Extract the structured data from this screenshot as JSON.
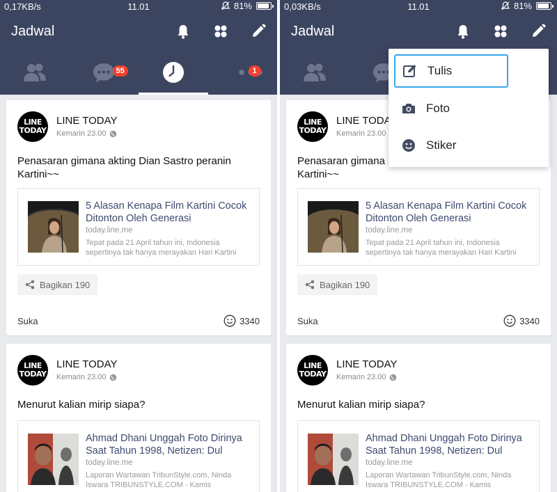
{
  "status_left": {
    "speed": "0,17KB/s",
    "time": "11.01",
    "battery": "81%",
    "battery_level": 0.81
  },
  "status_right": {
    "speed": "0,03KB/s",
    "time": "11.01",
    "battery": "81%",
    "battery_level": 0.81
  },
  "appbar": {
    "title": "Jadwal",
    "icons": [
      "bell-icon",
      "apps-grid-icon",
      "pencil-icon"
    ]
  },
  "tabs": [
    {
      "icon": "friends-icon",
      "badge": ""
    },
    {
      "icon": "chat-icon",
      "badge": "55"
    },
    {
      "icon": "timeline-clock-icon",
      "badge": "",
      "active": true
    },
    {
      "icon": "more-icon",
      "badge": "1"
    }
  ],
  "posts": [
    {
      "author": "LINE TODAY",
      "avatar_text": "LINE TODAY",
      "time": "Kemarin 23.00",
      "text": "Penasaran gimana akting Dian Sastro peranin Kartini~~",
      "link": {
        "title": "5 Alasan Kenapa Film Kartini Cocok Ditonton Oleh Generasi",
        "domain": "today.line.me",
        "description": "Tepat pada 21 April tahun ini, Indonesia sepertinya tak hanya merayakan Hari Kartini"
      },
      "share_label": "Bagikan 190",
      "like_label": "Suka",
      "reaction_count": "3340"
    },
    {
      "author": "LINE TODAY",
      "avatar_text": "LINE TODAY",
      "time": "Kemarin 23.00",
      "text": "Menurut kalian mirip siapa?",
      "link": {
        "title": "Ahmad Dhani Unggah Foto Dirinya Saat Tahun 1998, Netizen: Dul",
        "domain": "today.line.me",
        "description": "Laporan Wartawan TribunStyle.com, Ninda Iswara TRIBUNSTYLE.COM - Kamis"
      }
    }
  ],
  "write_menu": {
    "items": [
      {
        "label": "Tulis",
        "icon": "edit-note-icon",
        "focused": true
      },
      {
        "label": "Foto",
        "icon": "camera-icon"
      },
      {
        "label": "Stiker",
        "icon": "sticker-face-icon"
      }
    ]
  },
  "colors": {
    "header": "#3c4560",
    "badge": "#f2402e",
    "link_title": "#3c4a6e",
    "focus_ring": "#38a4ec",
    "feed_bg": "#e9eaee"
  }
}
